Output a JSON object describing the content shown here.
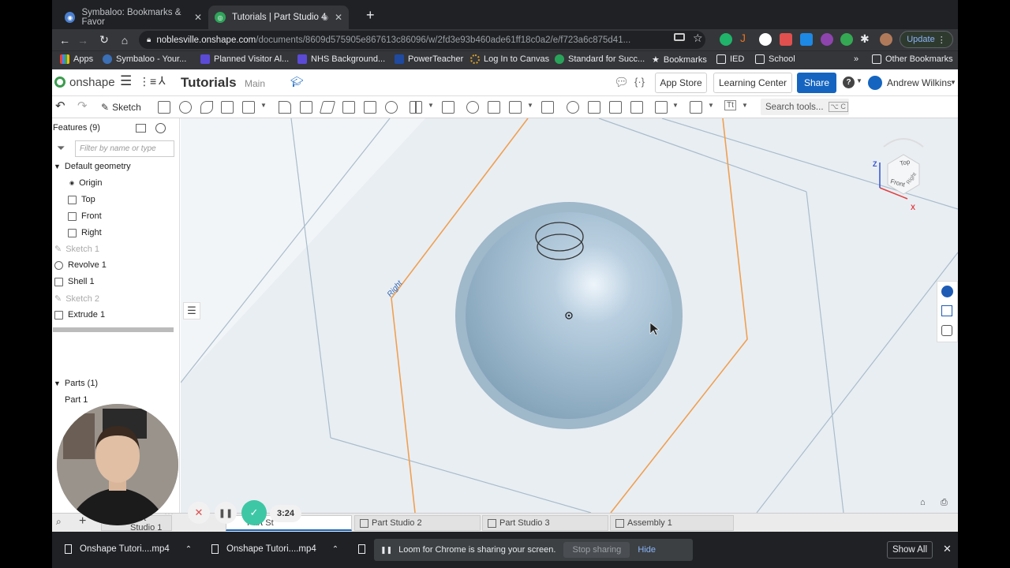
{
  "browser": {
    "tabs": [
      {
        "label": "Symbaloo: Bookmarks & Favor"
      },
      {
        "label": "Tutorials | Part Studio 4"
      }
    ],
    "url_host": "noblesville.onshape.com",
    "url_path": "/documents/8609d575905e867613c86096/w/2fd3e93b460ade61ff18c0a2/e/f723a6c875d41...",
    "update_label": "Update",
    "bookmarks": [
      "Apps",
      "Symbaloo - Your...",
      "Planned Visitor Al...",
      "NHS Background...",
      "PowerTeacher",
      "Log In to Canvas",
      "Standard for Succ...",
      "Bookmarks",
      "IED",
      "School",
      "Other Bookmarks"
    ],
    "more_bookmarks": "»"
  },
  "app": {
    "logo_text": "onshape",
    "doc_title": "Tutorials",
    "branch": "Main",
    "app_store_label": "App Store",
    "learning_center_label": "Learning Center",
    "share_label": "Share",
    "help_label": "?",
    "user_name": "Andrew Wilkins"
  },
  "toolbar": {
    "sketch_label": "Sketch",
    "search_label": "Search tools...",
    "search_shortcut": "⌥ C",
    "text_tool": "Tt"
  },
  "features": {
    "header": "Features (9)",
    "filter_placeholder": "Filter by name or type",
    "default_geometry": "Default geometry",
    "items": [
      {
        "label": "Origin"
      },
      {
        "label": "Top"
      },
      {
        "label": "Front"
      },
      {
        "label": "Right"
      },
      {
        "label": "Sketch 1"
      },
      {
        "label": "Revolve 1"
      },
      {
        "label": "Shell 1"
      },
      {
        "label": "Sketch 2"
      },
      {
        "label": "Extrude 1"
      }
    ],
    "parts_header": "Parts (1)",
    "part1": "Part 1"
  },
  "viewport": {
    "plane_label": "Right",
    "cube": {
      "top": "Top",
      "front": "Front",
      "right": "Right",
      "z": "Z",
      "x": "X"
    }
  },
  "bottom_tabs": [
    {
      "label": "Part Studio 1"
    },
    {
      "label": "Part St"
    },
    {
      "label": "Part Studio 2"
    },
    {
      "label": "Part Studio 3"
    },
    {
      "label": "Assembly 1"
    }
  ],
  "loom": {
    "timer": "3:24",
    "message": "Loom for Chrome is sharing your screen.",
    "stop_label": "Stop sharing",
    "hide_label": "Hide"
  },
  "downloads": [
    {
      "label": "Onshape Tutori....mp4"
    },
    {
      "label": "Onshape Tutori....mp4"
    }
  ],
  "show_all_label": "Show All",
  "colors": {
    "accent": "#1565c0",
    "plane_orange": "#f0a050",
    "part_blue": "#a9c3d6"
  }
}
